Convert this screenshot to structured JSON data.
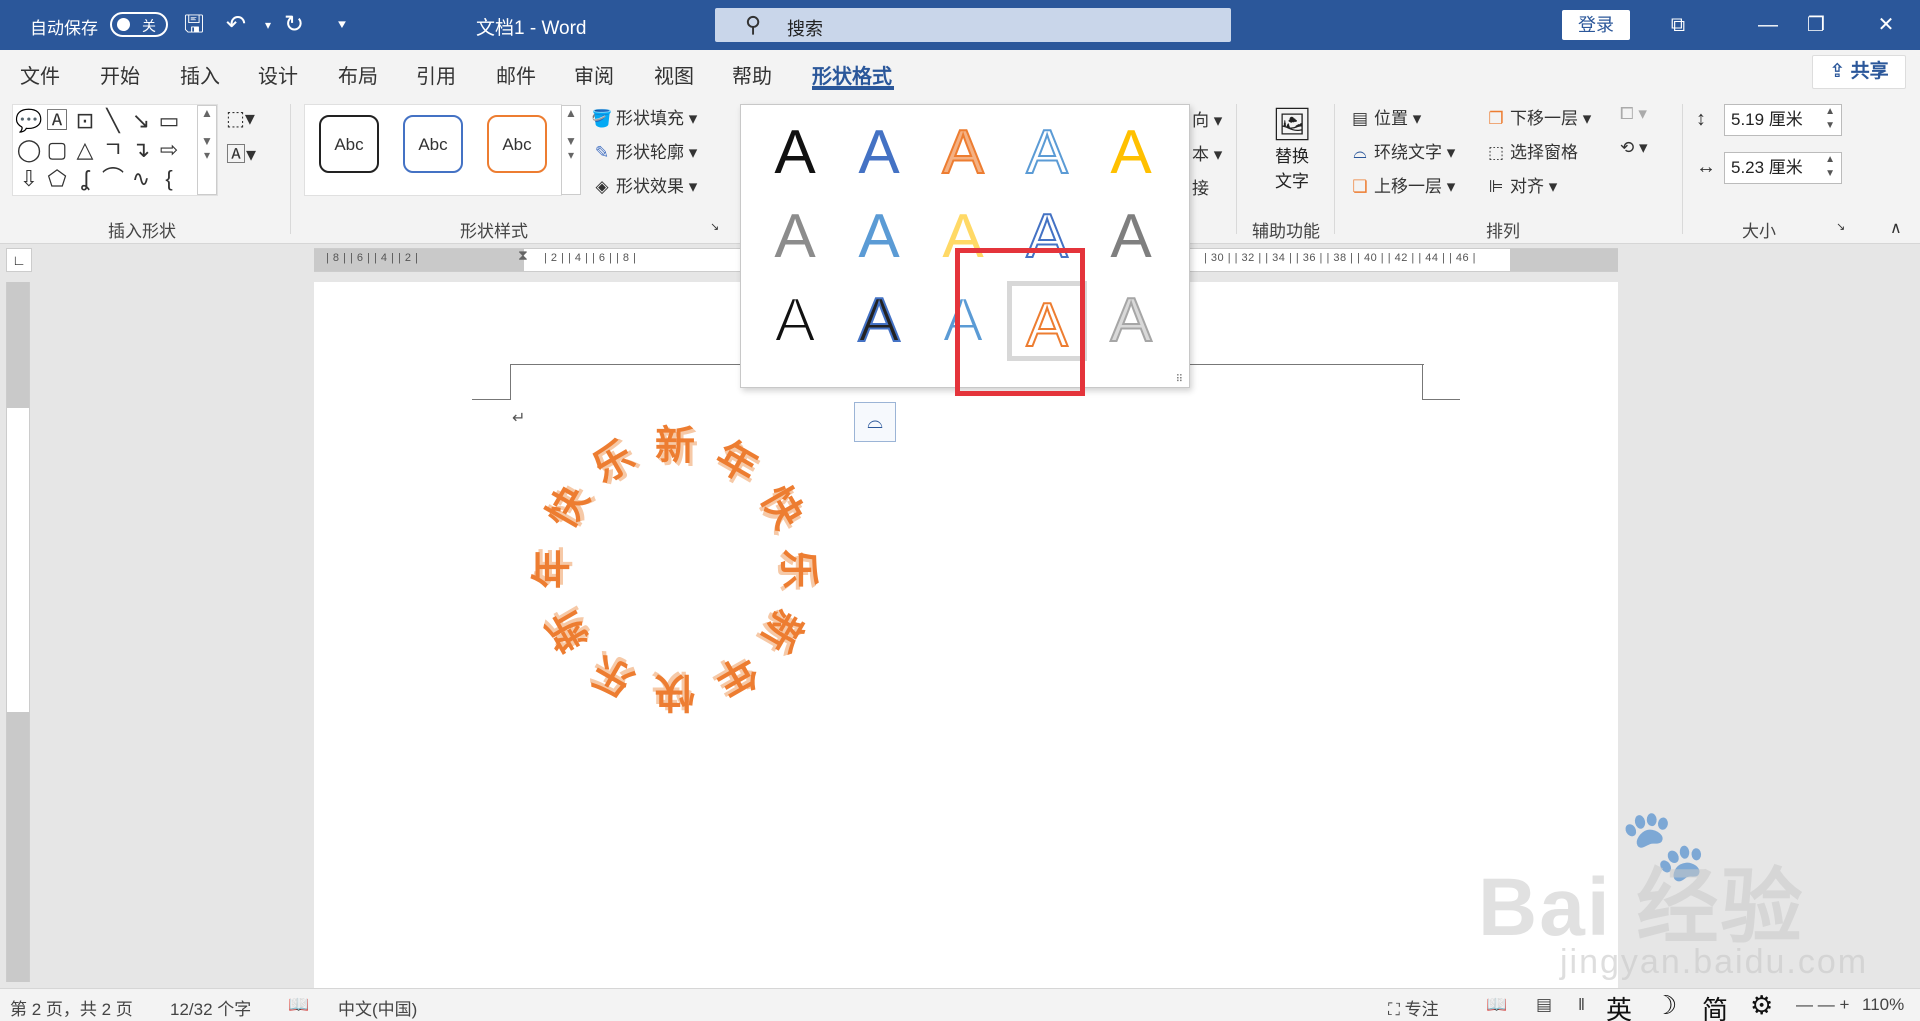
{
  "titlebar": {
    "autosave_label": "自动保存",
    "autosave_state": "关",
    "doc_title": "文档1  -  Word",
    "search_placeholder": "搜索",
    "login_label": "登录"
  },
  "tabs": [
    {
      "label": "文件"
    },
    {
      "label": "开始"
    },
    {
      "label": "插入"
    },
    {
      "label": "设计"
    },
    {
      "label": "布局"
    },
    {
      "label": "引用"
    },
    {
      "label": "邮件"
    },
    {
      "label": "审阅"
    },
    {
      "label": "视图"
    },
    {
      "label": "帮助"
    },
    {
      "label": "形状格式",
      "active": true
    }
  ],
  "share_label": "共享",
  "ribbon": {
    "insert_shapes_label": "插入形状",
    "shape_styles_label": "形状样式",
    "style_preset": "Abc",
    "shape_fill": "形状填充",
    "shape_outline": "形状轮廓",
    "shape_effects": "形状效果",
    "partial_direction": "向",
    "partial_text": "本",
    "partial_link": "接",
    "alt_text_line1": "替换",
    "alt_text_line2": "文字",
    "accessibility_label": "辅助功能",
    "position": "位置",
    "wrap_text": "环绕文字",
    "bring_forward": "上移一层",
    "send_backward": "下移一层",
    "selection_pane": "选择窗格",
    "align": "对齐",
    "arrange_label": "排列",
    "height_value": "5.19 厘米",
    "width_value": "5.23 厘米",
    "size_label": "大小"
  },
  "gallery": {
    "glyph": "A",
    "styles": [
      {
        "color": "#111111",
        "outline": "none"
      },
      {
        "color": "#4472c4",
        "outline": "none"
      },
      {
        "color": "#f4b183",
        "outline": "#ed7d31"
      },
      {
        "color": "#ffffff",
        "outline": "#5b9bd5"
      },
      {
        "color": "#ffc000",
        "outline": "none"
      },
      {
        "color": "#8c8c8c",
        "outline": "none"
      },
      {
        "color": "#5b9bd5",
        "outline": "none"
      },
      {
        "color": "#ffd966",
        "outline": "none"
      },
      {
        "color": "#ffffff",
        "outline": "#4472c4"
      },
      {
        "color": "#7f7f7f",
        "outline": "none"
      },
      {
        "color": "#111111",
        "outline": "#ffffff"
      },
      {
        "color": "#222222",
        "outline": "#4472c4"
      },
      {
        "color": "#5b9bd5",
        "outline": "#ffffff"
      },
      {
        "color": "#ffffff",
        "outline": "#ed7d31"
      },
      {
        "color": "#d9d9d9",
        "outline": "#a6a6a6"
      }
    ],
    "selected_index": 13
  },
  "ruler": {
    "left_numbers": "| 8 |   | 6 |   | 4 |   | 2 |",
    "center_numbers": "| 2 |   | 4 |   | 6 |   | 8 |",
    "right_numbers": "| 30 |  | 32 |  | 34 |  | 36 |  | 38 |  | 40 |  | 42 |  | 44 |  | 46 |"
  },
  "document": {
    "para_mark": "↵",
    "wordart_text": "新年快乐新年快乐新年快乐"
  },
  "statusbar": {
    "page": "第 2 页，共 2 页",
    "words": "12/32 个字",
    "language": "中文(中国)",
    "focus": "专注",
    "ime_lang": "英",
    "ime_moon": "☽",
    "ime_script": "简",
    "zoom": "110%"
  },
  "watermark": {
    "brand": "Bai 经验",
    "url": "jingyan.baidu.com"
  }
}
